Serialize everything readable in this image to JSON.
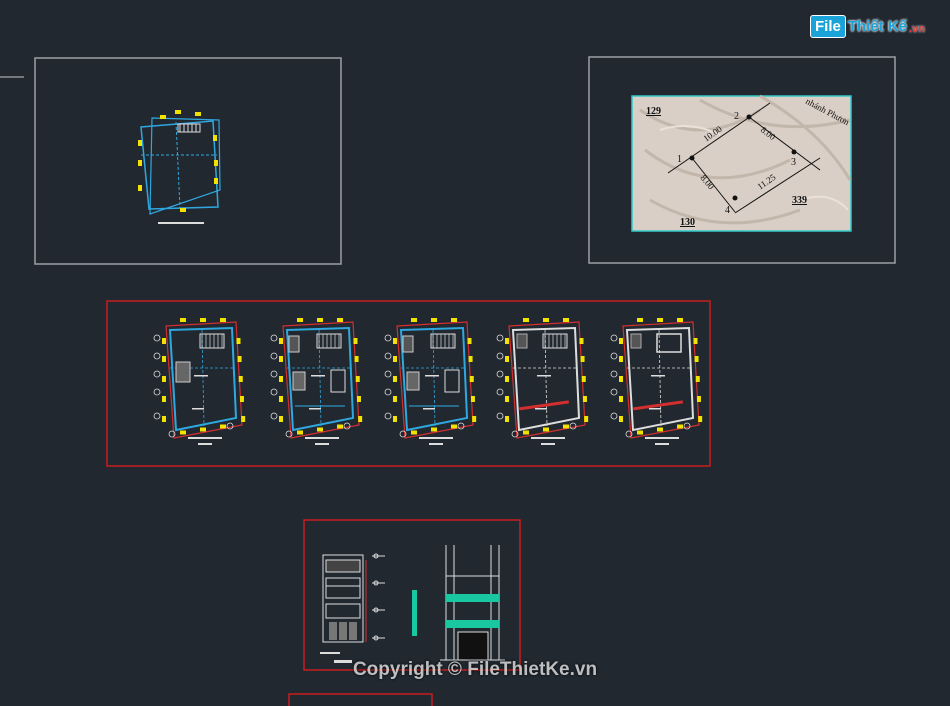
{
  "logo": {
    "badge": "File",
    "text": "Thiết Kế",
    "tld": ".vn"
  },
  "watermark": "Copyright © FileThietKe.vn",
  "site_plan": {
    "lot_left": "129",
    "lot_bottom_left": "130",
    "lot_right": "339",
    "street": "nhánh Phươn",
    "points": [
      "1",
      "2",
      "3",
      "4"
    ],
    "dimensions": [
      "10.00",
      "8.00",
      "8.00",
      "11.25"
    ]
  },
  "colors": {
    "background": "#212830",
    "sheet_border_gray": "#9aa0a6",
    "sheet_border_red": "#c81e1e",
    "wall_cyan": "#2fa8e0",
    "dim_red": "#d32f2f",
    "marker_yellow": "#f2e200",
    "green_fill": "#19c7a0"
  },
  "icons": [
    "file-thietke-logo-icon"
  ]
}
